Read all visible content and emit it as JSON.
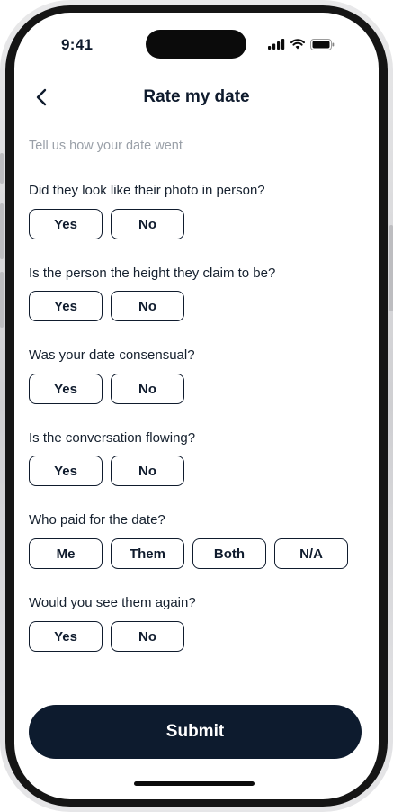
{
  "status_bar": {
    "time": "9:41"
  },
  "header": {
    "title": "Rate my date"
  },
  "subtitle": "Tell us how your date went",
  "questions": [
    {
      "text": "Did they look like their photo in person?",
      "options": [
        "Yes",
        "No"
      ]
    },
    {
      "text": "Is the person the height they claim to be?",
      "options": [
        "Yes",
        "No"
      ]
    },
    {
      "text": "Was your date consensual?",
      "options": [
        "Yes",
        "No"
      ]
    },
    {
      "text": "Is the conversation flowing?",
      "options": [
        "Yes",
        "No"
      ]
    },
    {
      "text": "Who paid for the date?",
      "options": [
        "Me",
        "Them",
        "Both",
        "N/A"
      ]
    },
    {
      "text": "Would you see them again?",
      "options": [
        "Yes",
        "No"
      ]
    }
  ],
  "submit_label": "Submit",
  "colors": {
    "primary": "#0d1b2e",
    "muted_text": "#9aa0a8",
    "background": "#ffffff"
  }
}
